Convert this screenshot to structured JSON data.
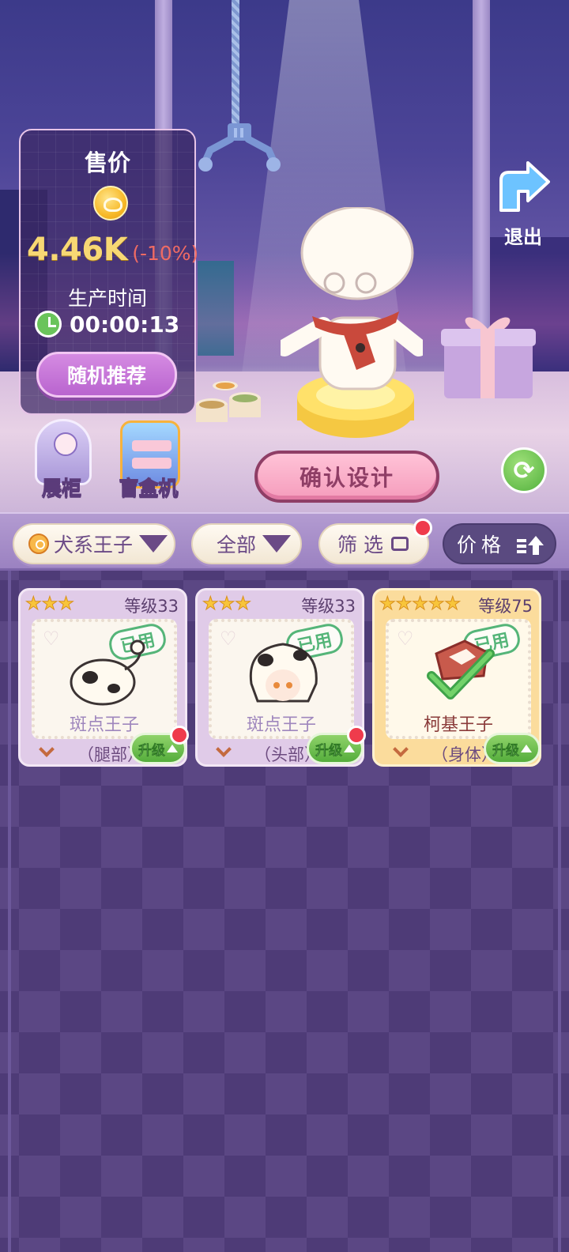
{
  "price_panel": {
    "title": "售价",
    "icon": "coin-icon",
    "price": "4.46K",
    "discount": "(-10%)",
    "production_label": "生产时间",
    "production_time": "00:00:13",
    "random_button": "随机推荐"
  },
  "side_buttons": {
    "cabinet": "展柜",
    "blindbox": "盲盒机"
  },
  "exit": {
    "label": "退出",
    "icon": "exit-arrow-icon"
  },
  "confirm_button": "确认设计",
  "refresh": {
    "icon": "refresh-icon",
    "glyph": "⟳"
  },
  "filters": {
    "series": "犬系王子",
    "category": "全部",
    "filter": "筛选",
    "sort": "价格"
  },
  "items": [
    {
      "stars": 3,
      "level": "等级33",
      "used": "已用",
      "name": "斑点王子",
      "part": "（腿部）",
      "upgrade": "升级",
      "has_alert": true,
      "tier": "normal"
    },
    {
      "stars": 3,
      "level": "等级33",
      "used": "已用",
      "name": "斑点王子",
      "part": "（头部）",
      "upgrade": "升级",
      "has_alert": true,
      "tier": "normal"
    },
    {
      "stars": 5,
      "level": "等级75",
      "used": "已用",
      "name": "柯基王子",
      "part": "（身体）",
      "upgrade": "升级",
      "has_alert": false,
      "tier": "gold"
    }
  ],
  "colors": {
    "accent_pink": "#f59cbc",
    "coin_gold": "#f7b928",
    "upgrade_green": "#55ad3c",
    "alert_red": "#ef3b4c"
  }
}
